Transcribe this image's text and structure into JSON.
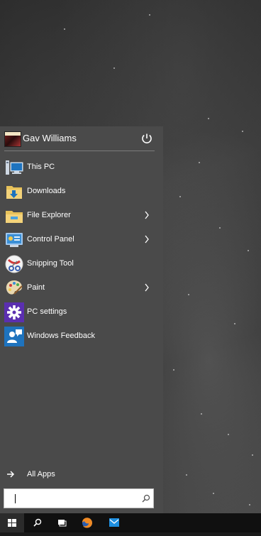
{
  "user": {
    "name": "Gav Williams",
    "avatar_icon": "user-avatar"
  },
  "menu": {
    "items": [
      {
        "label": "This PC",
        "icon": "computer-icon",
        "has_submenu": false
      },
      {
        "label": "Downloads",
        "icon": "downloads-folder-icon",
        "has_submenu": false
      },
      {
        "label": "File Explorer",
        "icon": "file-explorer-icon",
        "has_submenu": true
      },
      {
        "label": "Control Panel",
        "icon": "control-panel-icon",
        "has_submenu": true
      },
      {
        "label": "Snipping Tool",
        "icon": "snipping-tool-icon",
        "has_submenu": false
      },
      {
        "label": "Paint",
        "icon": "paint-palette-icon",
        "has_submenu": true
      },
      {
        "label": "PC settings",
        "icon": "settings-gear-icon",
        "has_submenu": false
      },
      {
        "label": "Windows Feedback",
        "icon": "feedback-icon",
        "has_submenu": false
      }
    ],
    "all_apps_label": "All Apps"
  },
  "search": {
    "placeholder": "",
    "value": ""
  },
  "taskbar": {
    "items": [
      "start-button",
      "search-button",
      "task-view-button",
      "firefox",
      "mail"
    ]
  },
  "colors": {
    "menu_bg": "#4a4a4a",
    "taskbar_bg": "#101010",
    "text": "#ffffff",
    "accent_blue": "#1e73be"
  }
}
